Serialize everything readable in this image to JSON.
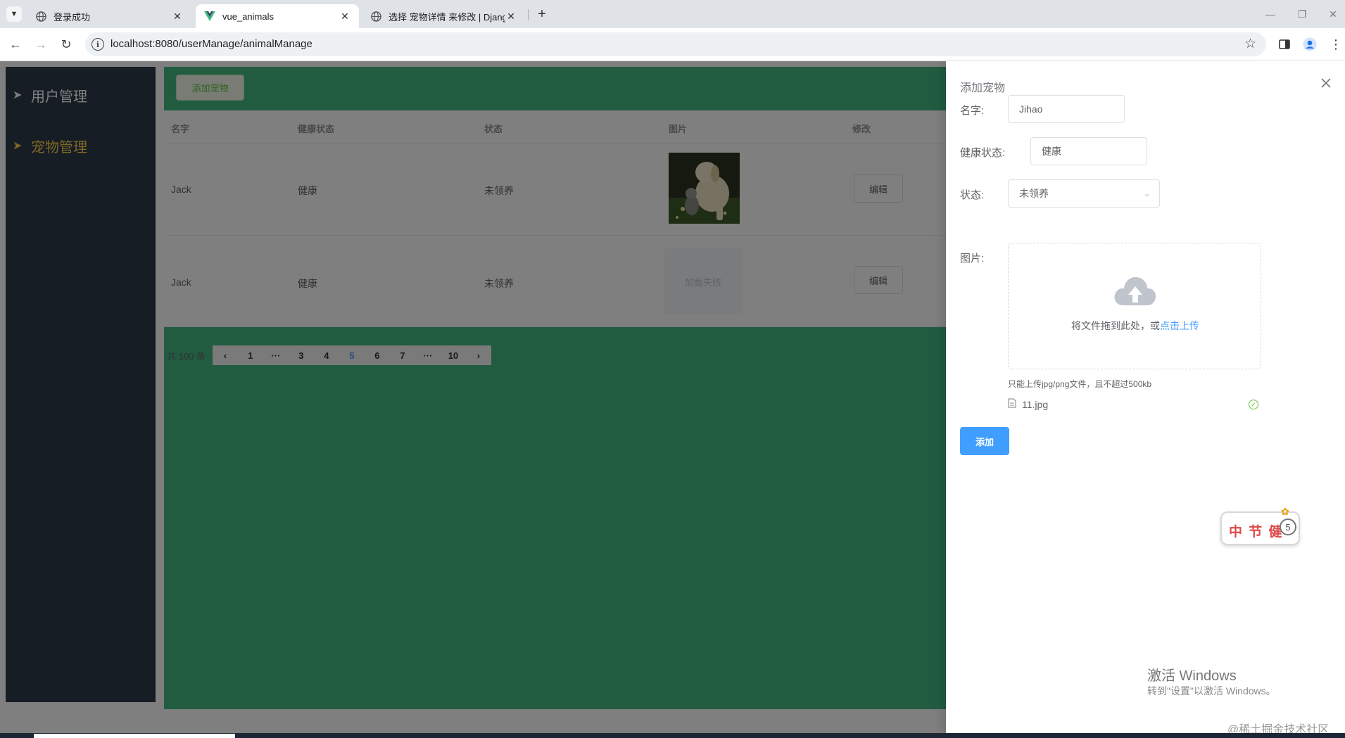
{
  "browser": {
    "tabs": [
      {
        "label": "登录成功",
        "active": false,
        "icon": "globe-icon"
      },
      {
        "label": "vue_animals",
        "active": true,
        "icon": "vue-logo-icon"
      },
      {
        "label": "选择 宠物详情 来修改 | Django",
        "active": false,
        "icon": "globe-icon"
      }
    ],
    "url": "localhost:8080/userManage/animalManage"
  },
  "sidebar": {
    "items": [
      {
        "label": "用户管理",
        "icon": "paper-plane-icon",
        "active": false
      },
      {
        "label": "宠物管理",
        "icon": "paper-plane-icon",
        "active": true
      }
    ]
  },
  "main": {
    "add_button_label": "添加宠物",
    "table": {
      "columns": [
        "名字",
        "健康状态",
        "状态",
        "图片",
        "修改"
      ],
      "rows": [
        {
          "name": "Jack",
          "health": "健康",
          "status": "未领养",
          "image": "puppy-kitten-photo",
          "edit_label": "编辑"
        },
        {
          "name": "Jack",
          "health": "健康",
          "status": "未领养",
          "image_error": "加载失败",
          "edit_label": "编辑"
        }
      ]
    },
    "pagination": {
      "total_label": "共 100 条",
      "pages": [
        "1",
        "···",
        "3",
        "4",
        "5",
        "6",
        "7",
        "···",
        "10"
      ],
      "current": "5"
    }
  },
  "drawer": {
    "title": "添加宠物",
    "fields": {
      "name": {
        "label": "名字:",
        "value": "Jihao"
      },
      "health": {
        "label": "健康状态:",
        "value": "健康"
      },
      "status": {
        "label": "状态:",
        "value": "未领养"
      },
      "image": {
        "label": "图片:"
      }
    },
    "upload": {
      "text": "将文件拖到此处，或",
      "link": "点击上传",
      "tip": "只能上传jpg/png文件，且不超过500kb",
      "file_name": "11.jpg"
    },
    "submit_label": "添加",
    "sticker_text": "中 节 健",
    "sticker_badge": "5"
  },
  "overlay": {
    "activate_title": "激活 Windows",
    "activate_sub": "转到\"设置\"以激活 Windows。",
    "watermark": "@稀土掘金技术社区"
  },
  "colors": {
    "brand_green": "#42b983",
    "sidebar_bg": "#2d3a4b",
    "primary": "#409eff",
    "active_menu": "#ffd04b"
  }
}
